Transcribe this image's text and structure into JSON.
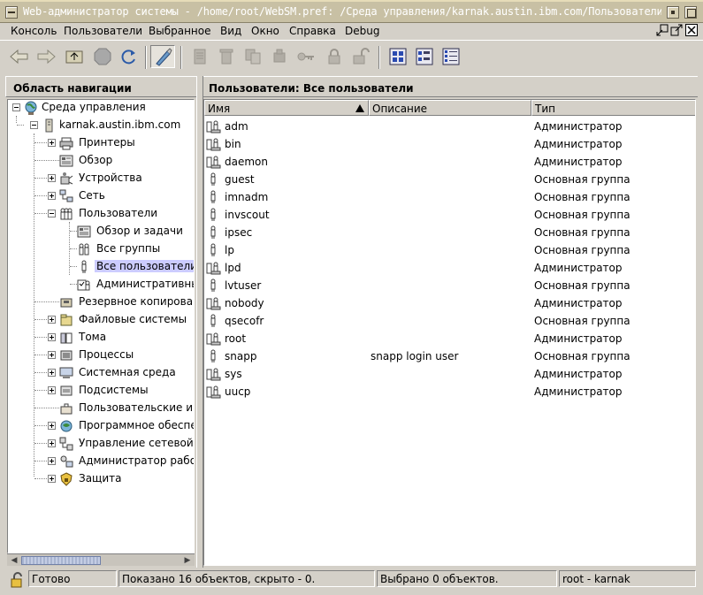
{
  "window": {
    "title": "Web-администратор системы - /home/root/WebSM.pref: /Среда управления/karnak.austin.ibm.com/Пользователи"
  },
  "menu": {
    "items": [
      "Консоль",
      "Пользователи",
      "Выбранное",
      "Вид",
      "Окно",
      "Справка",
      "Debug"
    ]
  },
  "toolbar": {
    "buttons": [
      "back-arrow-icon",
      "forward-arrow-icon",
      "up-folder-icon",
      "stop-icon",
      "reload-icon",
      "find-icon",
      "copy-icon",
      "delete-icon",
      "duplicate-icon",
      "properties-icon",
      "key-icon",
      "lock-icon",
      "unlock-icon",
      "large-icons-view-icon",
      "small-icons-view-icon",
      "details-view-icon"
    ]
  },
  "nav": {
    "header": "Область навигации",
    "root": "Среда управления",
    "host": "karnak.austin.ibm.com",
    "items": [
      {
        "label": "Принтеры",
        "icon": "printer-icon",
        "expander": "plus"
      },
      {
        "label": "Обзор",
        "icon": "overview-icon",
        "expander": "none"
      },
      {
        "label": "Устройства",
        "icon": "devices-icon",
        "expander": "plus"
      },
      {
        "label": "Сеть",
        "icon": "network-icon",
        "expander": "plus"
      },
      {
        "label": "Пользователи",
        "icon": "users-icon",
        "expander": "minus"
      },
      {
        "label": "Обзор и задачи",
        "icon": "overview-tasks-icon",
        "expander": "none",
        "child": true
      },
      {
        "label": "Все группы",
        "icon": "groups-icon",
        "expander": "none",
        "child": true
      },
      {
        "label": "Все пользователи",
        "icon": "user-icon",
        "expander": "none",
        "child": true,
        "selected": true
      },
      {
        "label": "Административны",
        "icon": "admin-roles-icon",
        "expander": "none",
        "child": true
      },
      {
        "label": "Резервное копирован",
        "icon": "backup-icon",
        "expander": "none"
      },
      {
        "label": "Файловые системы",
        "icon": "filesystems-icon",
        "expander": "plus"
      },
      {
        "label": "Тома",
        "icon": "volumes-icon",
        "expander": "plus"
      },
      {
        "label": "Процессы",
        "icon": "processes-icon",
        "expander": "plus"
      },
      {
        "label": "Системная среда",
        "icon": "system-environment-icon",
        "expander": "plus"
      },
      {
        "label": "Подсистемы",
        "icon": "subsystems-icon",
        "expander": "plus"
      },
      {
        "label": "Пользовательские ин",
        "icon": "custom-tools-icon",
        "expander": "none"
      },
      {
        "label": "Программное обеспеч",
        "icon": "software-icon",
        "expander": "plus"
      },
      {
        "label": "Управление сетевой у",
        "icon": "network-install-icon",
        "expander": "plus"
      },
      {
        "label": "Администратор рабоч",
        "icon": "workload-manager-icon",
        "expander": "plus"
      },
      {
        "label": "Защита",
        "icon": "security-icon",
        "expander": "plus"
      }
    ]
  },
  "content": {
    "header": "Пользователи: Все пользователи",
    "columns": [
      "Имя",
      "Описание",
      "Тип"
    ],
    "rows": [
      {
        "name": "adm",
        "description": "",
        "type": "Администратор",
        "icon": "admin-user-icon"
      },
      {
        "name": "bin",
        "description": "",
        "type": "Администратор",
        "icon": "admin-user-icon"
      },
      {
        "name": "daemon",
        "description": "",
        "type": "Администратор",
        "icon": "admin-user-icon"
      },
      {
        "name": "guest",
        "description": "",
        "type": "Основная группа",
        "icon": "user-icon"
      },
      {
        "name": "imnadm",
        "description": "",
        "type": "Основная группа",
        "icon": "user-icon"
      },
      {
        "name": "invscout",
        "description": "",
        "type": "Основная группа",
        "icon": "user-icon"
      },
      {
        "name": "ipsec",
        "description": "",
        "type": "Основная группа",
        "icon": "user-icon"
      },
      {
        "name": "lp",
        "description": "",
        "type": "Основная группа",
        "icon": "user-icon"
      },
      {
        "name": "lpd",
        "description": "",
        "type": "Администратор",
        "icon": "admin-user-icon"
      },
      {
        "name": "lvtuser",
        "description": "",
        "type": "Основная группа",
        "icon": "user-icon"
      },
      {
        "name": "nobody",
        "description": "",
        "type": "Администратор",
        "icon": "admin-user-icon"
      },
      {
        "name": "qsecofr",
        "description": "",
        "type": "Основная группа",
        "icon": "user-icon"
      },
      {
        "name": "root",
        "description": "",
        "type": "Администратор",
        "icon": "admin-user-icon"
      },
      {
        "name": "snapp",
        "description": "snapp login user",
        "type": "Основная группа",
        "icon": "user-icon"
      },
      {
        "name": "sys",
        "description": "",
        "type": "Администратор",
        "icon": "admin-user-icon"
      },
      {
        "name": "uucp",
        "description": "",
        "type": "Администратор",
        "icon": "admin-user-icon"
      }
    ]
  },
  "status": {
    "ready": "Готово",
    "shown": "Показано 16 объектов, скрыто - 0.",
    "selected": "Выбрано 0 объектов.",
    "user": "root - karnak"
  }
}
